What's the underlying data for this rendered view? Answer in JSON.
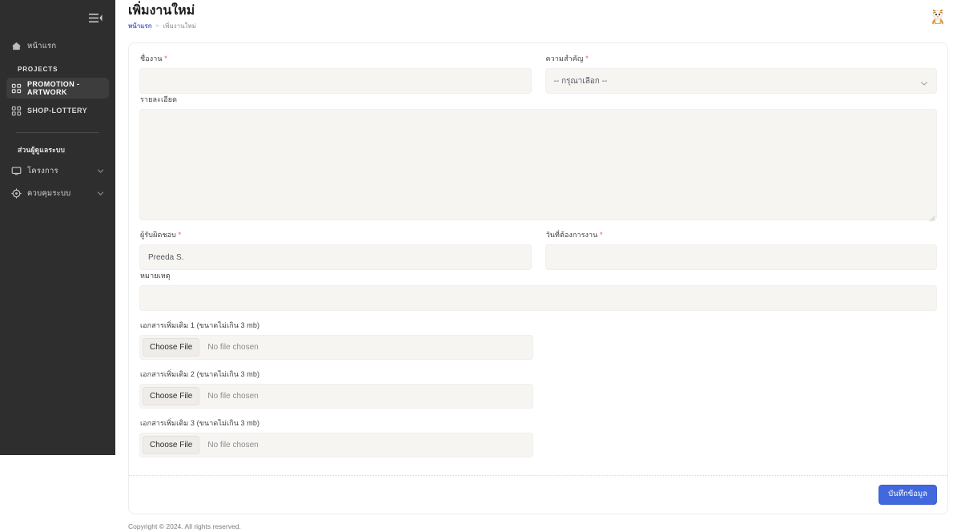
{
  "sidebar": {
    "collapse_icon": "menu-collapse-icon",
    "home": {
      "label": "หน้าแรก",
      "icon": "home-icon"
    },
    "projects_section": "PROJECTS",
    "projects": [
      {
        "label": "PROMOTION - ARTWORK",
        "icon": "grid-icon",
        "active": true
      },
      {
        "label": "SHOP-LOTTERY",
        "icon": "grid-icon",
        "active": false
      }
    ],
    "admin_section": "ส่วนผู้ดูแลระบบ",
    "admin": [
      {
        "label": "โครงการ",
        "icon": "monitor-icon",
        "chevron": "chevron-down-icon"
      },
      {
        "label": "ควบคุมระบบ",
        "icon": "gear-icon",
        "chevron": "chevron-down-icon"
      }
    ]
  },
  "header": {
    "title": "เพิ่มงานใหม่",
    "breadcrumb": {
      "home": "หน้าแรก",
      "separator": "»",
      "current": "เพิ่มงานใหม่"
    },
    "avatar": "user-avatar"
  },
  "form": {
    "job_name": {
      "label": "ชื่องาน",
      "required": "*",
      "value": "",
      "placeholder": ""
    },
    "priority": {
      "label": "ความสำคัญ",
      "required": "*",
      "selected": "-- กรุณาเลือก --",
      "options": [
        "-- กรุณาเลือก --"
      ]
    },
    "details": {
      "label": "รายละเอียด",
      "value": "",
      "placeholder": ""
    },
    "owner": {
      "label": "ผู้รับผิดชอบ",
      "required": "*",
      "value": "Preeda S."
    },
    "due_date": {
      "label": "วันที่ต้องการงาน",
      "required": "*",
      "value": "",
      "placeholder": ""
    },
    "remark": {
      "label": "หมายเหตุ",
      "value": "",
      "placeholder": ""
    },
    "attachments": [
      {
        "label": "เอกสารเพิ่มเติม 1 (ขนาดไม่เกิน 3 mb)",
        "button": "Choose File",
        "status": "No file chosen"
      },
      {
        "label": "เอกสารเพิ่มเติม 2 (ขนาดไม่เกิน 3 mb)",
        "button": "Choose File",
        "status": "No file chosen"
      },
      {
        "label": "เอกสารเพิ่มเติม 3 (ขนาดไม่เกิน 3 mb)",
        "button": "Choose File",
        "status": "No file chosen"
      }
    ],
    "save_button": "บันทึกข้อมูล"
  },
  "footer": {
    "copyright": "Copyright © 2024. All rights reserved."
  },
  "colors": {
    "sidebar_bg": "#2e2e2e",
    "accent_blue": "#4169dd",
    "breadcrumb_link": "#4b62c8",
    "required_red": "#e0564f",
    "input_bg": "#f6f5f2"
  }
}
